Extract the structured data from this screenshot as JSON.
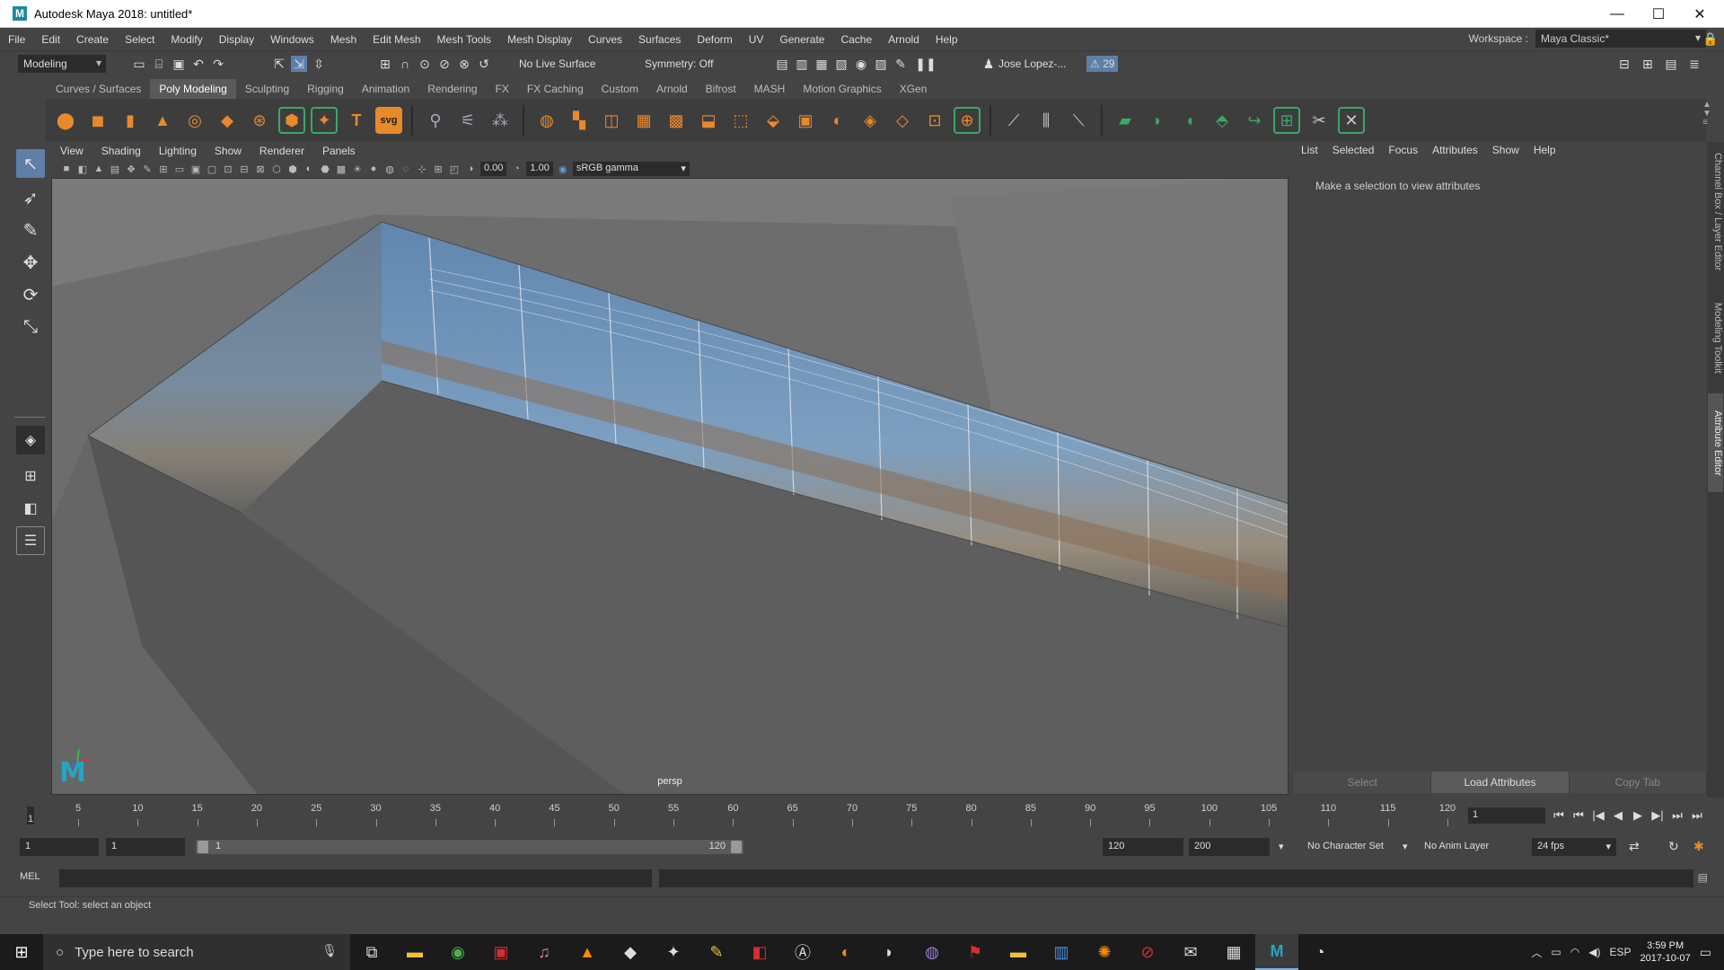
{
  "window": {
    "title": "Autodesk Maya 2018: untitled*",
    "app_letter": "M",
    "minimize": "—",
    "maximize": "☐",
    "close": "✕"
  },
  "menubar": {
    "items": [
      "File",
      "Edit",
      "Create",
      "Select",
      "Modify",
      "Display",
      "Windows",
      "Mesh",
      "Edit Mesh",
      "Mesh Tools",
      "Mesh Display",
      "Curves",
      "Surfaces",
      "Deform",
      "UV",
      "Generate",
      "Cache",
      "Arnold",
      "Help"
    ]
  },
  "workspace": {
    "label": "Workspace :",
    "value": "Maya Classic*"
  },
  "statusline": {
    "mode": "Modeling",
    "live_surface": "No Live Surface",
    "symmetry": "Symmetry: Off",
    "user": "Jose Lopez-...",
    "notifications": "29"
  },
  "shelf_tabs": [
    "Curves / Surfaces",
    "Poly Modeling",
    "Sculpting",
    "Rigging",
    "Animation",
    "Rendering",
    "FX",
    "FX Caching",
    "Custom",
    "Arnold",
    "Bifrost",
    "MASH",
    "Motion Graphics",
    "XGen"
  ],
  "active_shelf_tab": "Poly Modeling",
  "viewport": {
    "menu": [
      "View",
      "Shading",
      "Lighting",
      "Show",
      "Renderer",
      "Panels"
    ],
    "exposure": "0.00",
    "gamma": "1.00",
    "color_space": "sRGB gamma",
    "camera": "persp",
    "logo": "M"
  },
  "attribute_editor": {
    "menu": [
      "List",
      "Selected",
      "Focus",
      "Attributes",
      "Show",
      "Help"
    ],
    "hint": "Make a selection to view attributes",
    "buttons": {
      "select": "Select",
      "load": "Load Attributes",
      "copy": "Copy Tab"
    },
    "side_tabs": {
      "channel_box": "Channel Box / Layer Editor",
      "modeling_toolkit": "Modeling Toolkit",
      "attribute_editor": "Attribute Editor"
    }
  },
  "timeline": {
    "ticks": [
      "5",
      "10",
      "15",
      "20",
      "25",
      "30",
      "35",
      "40",
      "45",
      "50",
      "55",
      "60",
      "65",
      "70",
      "75",
      "80",
      "85",
      "90",
      "95",
      "100",
      "105",
      "110",
      "115",
      "120"
    ],
    "first_tick": "1",
    "current_frame": "1",
    "playback": [
      "⏮",
      "⏮",
      "|◀",
      "◀",
      "▶",
      "▶|",
      "⏭",
      "⏭"
    ]
  },
  "range": {
    "start": "1",
    "playback_start": "1",
    "slider_start": "1",
    "slider_end": "120",
    "playback_end": "120",
    "end": "200",
    "character_set": "No Character Set",
    "anim_layer": "No Anim Layer",
    "fps": "24 fps",
    "start_fraction": 0.0,
    "end_fraction": 1.0
  },
  "cmdline": {
    "lang": "MEL"
  },
  "helpline": "Select Tool: select an object",
  "taskbar": {
    "search_placeholder": "Type here to search",
    "lang": "ESP",
    "time": "3:59 PM",
    "date": "2017-10-07"
  },
  "colors": {
    "accent_blue": "#5d7fa8",
    "maya_teal": "#27a3c4",
    "shelf_orange": "#e8892c",
    "shelf_green": "#3aa866"
  }
}
